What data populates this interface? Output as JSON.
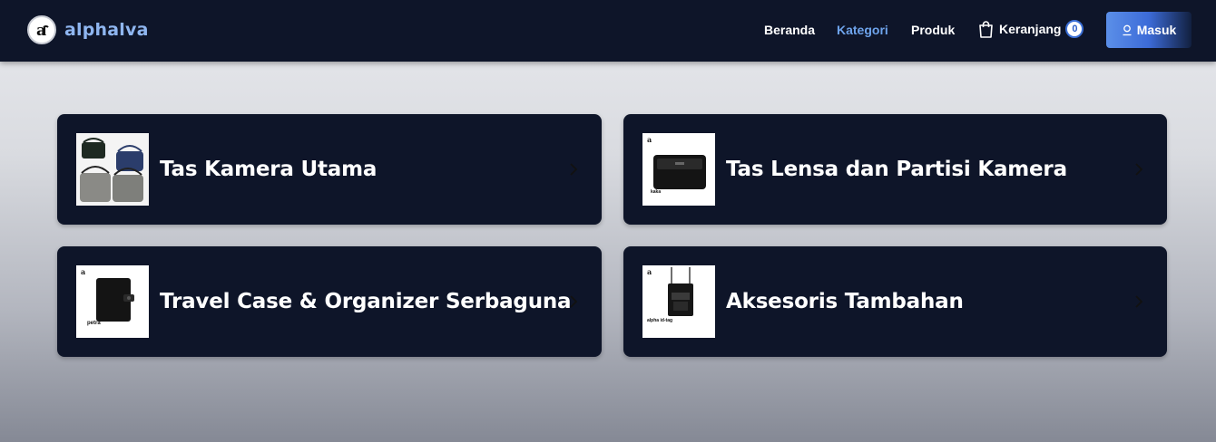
{
  "brand": {
    "name": "alphalva",
    "logo_glyph": "a"
  },
  "nav": {
    "items": [
      {
        "label": "Beranda",
        "active": false
      },
      {
        "label": "Kategori",
        "active": true
      },
      {
        "label": "Produk",
        "active": false
      }
    ],
    "cart_label": "Keranjang",
    "cart_count": "0",
    "login_label": "Masuk"
  },
  "categories": [
    {
      "title": "Tas Kamera Utama",
      "thumb": "camera-bags-image"
    },
    {
      "title": "Tas Lensa dan Partisi Kamera",
      "thumb": "lens-bag-image",
      "thumb_caption": "kaka"
    },
    {
      "title": "Travel Case & Organizer Serbaguna",
      "thumb": "travel-case-image",
      "thumb_caption": "petra"
    },
    {
      "title": "Aksesoris Tambahan",
      "thumb": "accessory-image",
      "thumb_caption": "alpha id-tag"
    }
  ],
  "colors": {
    "navbar_bg": "#0e1529",
    "brand_text": "#8fb6f0",
    "active_link": "#6ea4ec",
    "card_bg": "#0e1529",
    "button_accent": "#4a7de0"
  }
}
